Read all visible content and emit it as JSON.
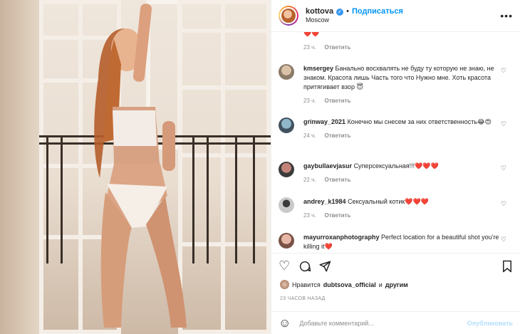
{
  "header": {
    "username": "kottova",
    "verified_icon": "verified-badge-icon",
    "separator": "•",
    "follow_label": "Подписаться",
    "location": "Moscow",
    "more_icon": "more-options-icon"
  },
  "comments": [
    {
      "user": "",
      "text": "",
      "emoji": "❤️❤️",
      "time": "23 ч.",
      "reply": "Ответить",
      "heart": false
    },
    {
      "user": "kmsergey",
      "text": "Банально восхвалять не буду ту которую не знаю, не знаком. Красота лишь Часть того что Нужно мне. Хоть красота притягивает взор",
      "emoji": "😇",
      "time": "23 ч.",
      "reply": "Ответить",
      "heart": true
    },
    {
      "user": "grinway_2021",
      "text": "Конечно мы снесем за них ответственность",
      "emoji": "😂😍",
      "time": "24 ч.",
      "reply": "Ответить",
      "heart": true
    },
    {
      "user": "gaybullaevjasur",
      "text": "Суперсексуальная!!!",
      "emoji": "❤️❤️❤️",
      "time": "22 ч.",
      "reply": "Ответить",
      "heart": true
    },
    {
      "user": "andrey_k1984",
      "text": "Сексуальный котик",
      "emoji": "❤️❤️❤️",
      "time": "23 ч.",
      "reply": "Ответить",
      "heart": true
    },
    {
      "user": "mayurroxanphotography",
      "text": "Perfect location for a beautiful shot you're killing it",
      "emoji": "❤️",
      "time": "",
      "reply": "",
      "heart": true
    }
  ],
  "actions": {
    "like_icon": "heart-icon",
    "comment_icon": "comment-icon",
    "share_icon": "share-icon",
    "save_icon": "bookmark-icon"
  },
  "likes": {
    "prefix": "Нравится",
    "user": "dubtsova_official",
    "conj": "и",
    "others": "другим"
  },
  "timestamp": "23 ЧАСОВ НАЗАД",
  "add_comment": {
    "placeholder": "Добавьте комментарий...",
    "post_label": "Опубликовать",
    "emoji_icon": "emoji-icon"
  },
  "colors": {
    "accent": "#0095f6",
    "heart": "#ed4956",
    "muted": "#8e8e8e",
    "text": "#262626"
  }
}
